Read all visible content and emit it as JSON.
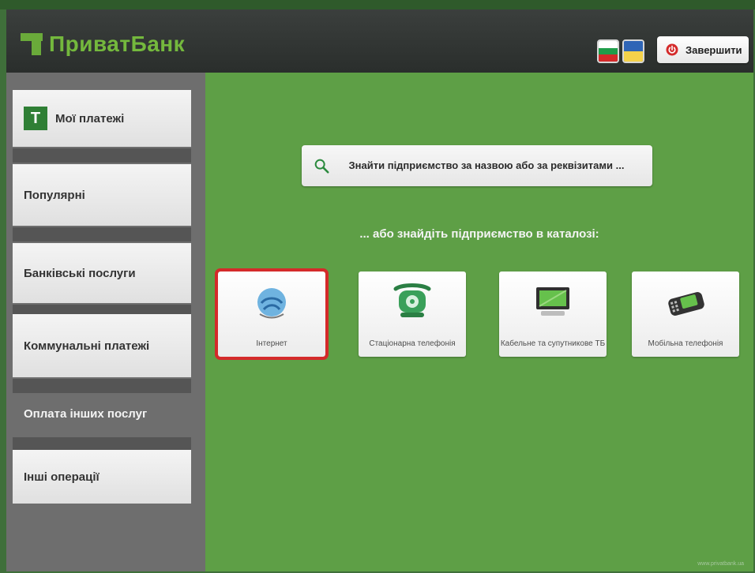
{
  "header": {
    "logo": "ПриватБанк",
    "finish_label": "Завершити"
  },
  "sidebar": {
    "items": [
      {
        "label": "Мої платежі"
      },
      {
        "label": "Популярні"
      },
      {
        "label": "Банківські послуги"
      },
      {
        "label": "Коммунальні платежі"
      },
      {
        "label": "Оплата інших послуг"
      },
      {
        "label": "Інші операції"
      }
    ]
  },
  "search": {
    "text": "Знайти підприємство за назвою або за реквізитами ..."
  },
  "catalog": {
    "subtitle": "... або знайдіть підприємство в каталозі:",
    "categories": [
      {
        "label": "Інтернет"
      },
      {
        "label": "Стаціонарна телефонія"
      },
      {
        "label": "Кабельне та супутникове ТБ"
      },
      {
        "label": "Мобільна телефонія"
      }
    ]
  },
  "footer": {
    "url": "www.privatbank.ua"
  },
  "colors": {
    "accent": "#5e9f46",
    "brand": "#74b83d",
    "selected_outline": "#d42a2a"
  }
}
